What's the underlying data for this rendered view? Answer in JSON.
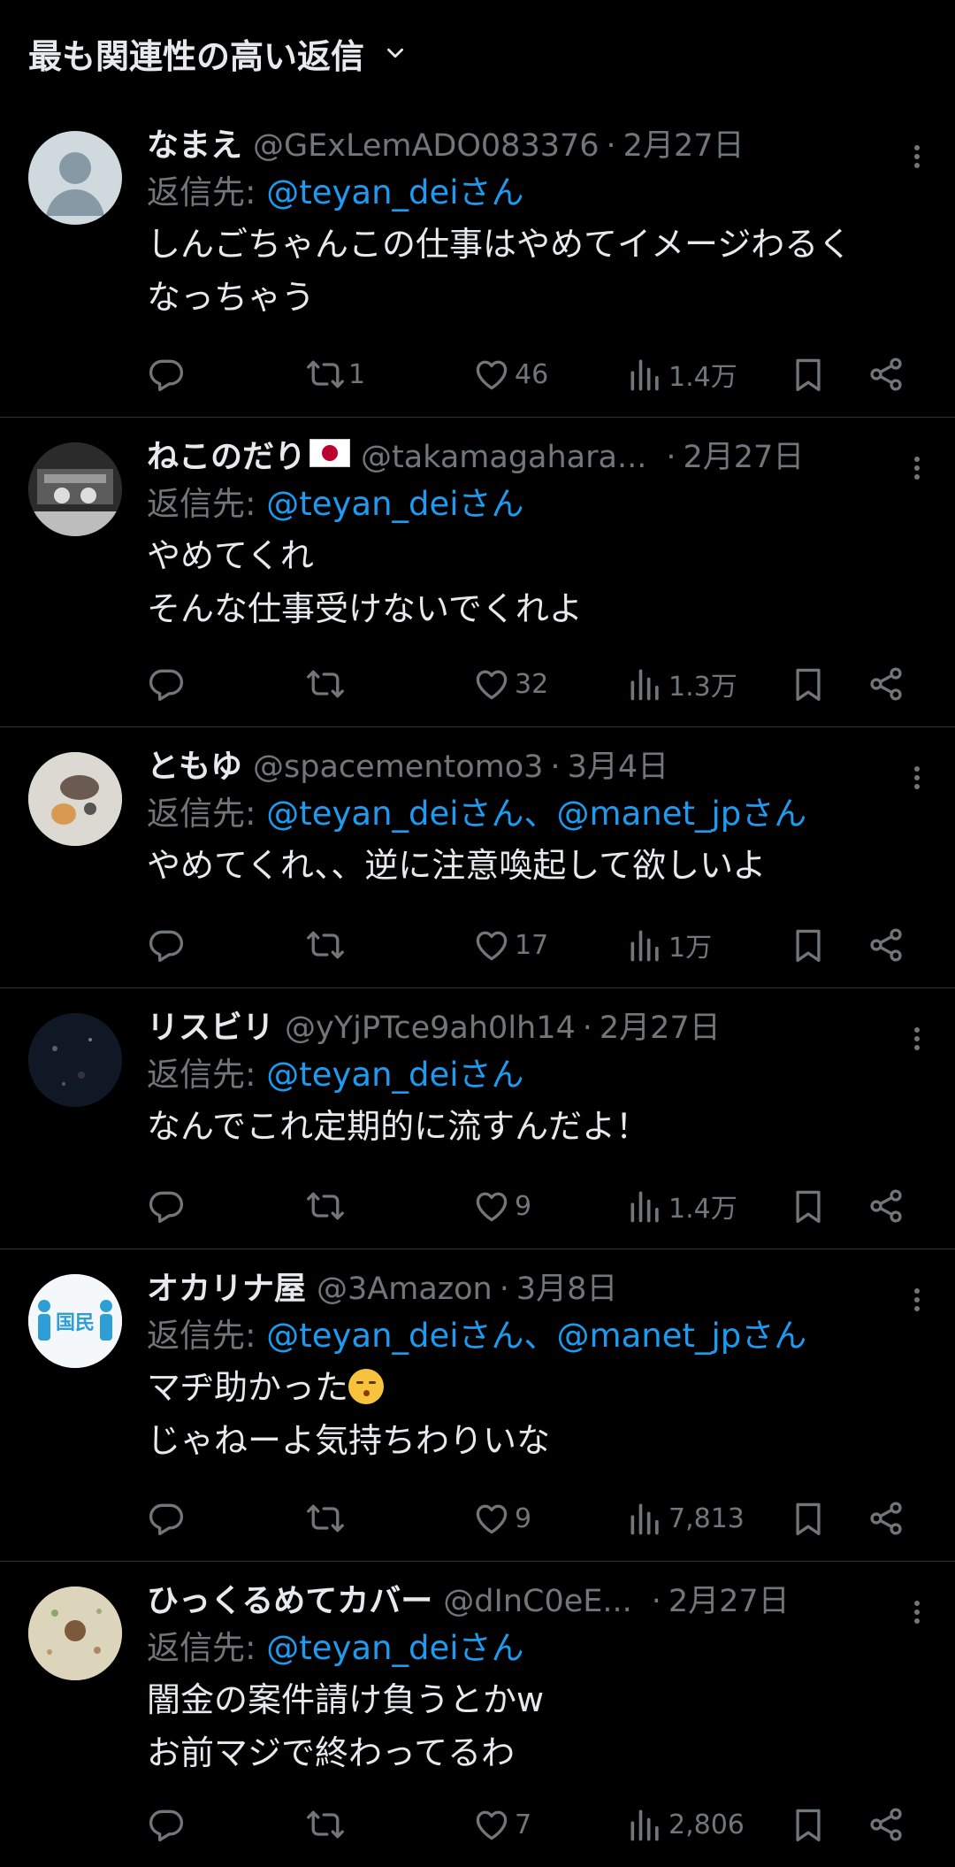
{
  "header": {
    "title": "最も関連性の高い返信"
  },
  "reply_prefix": "返信先:",
  "tweets": [
    {
      "name": "なまえ",
      "handle": "@GExLemADO083376",
      "date": "2月27日",
      "reply_to": "@teyan_deiさん",
      "text": "しんごちゃんこの仕事はやめてイメージわるく\nなっちゃう",
      "retweets": "1",
      "likes": "46",
      "views": "1.4万"
    },
    {
      "name": "ねこのだり",
      "handle": "@takamagahara...",
      "date": "2月27日",
      "reply_to": "@teyan_deiさん",
      "text": "やめてくれ\nそんな仕事受けないでくれよ",
      "retweets": "",
      "likes": "32",
      "views": "1.3万"
    },
    {
      "name": "ともゆ",
      "handle": "@spacementomo3",
      "date": "3月4日",
      "reply_to": "@teyan_deiさん、@manet_jpさん",
      "text": "やめてくれ、、逆に注意喚起して欲しいよ",
      "retweets": "",
      "likes": "17",
      "views": "1万"
    },
    {
      "name": "リスビリ",
      "handle": "@yYjPTce9ah0lh14",
      "date": "2月27日",
      "reply_to": "@teyan_deiさん",
      "text": "なんでこれ定期的に流すんだよ！",
      "retweets": "",
      "likes": "9",
      "views": "1.4万"
    },
    {
      "name": "オカリナ屋",
      "handle": "@3Amazon",
      "date": "3月8日",
      "reply_to": "@teyan_deiさん、@manet_jpさん",
      "text_line1": "マヂ助かった",
      "text_line2": "じゃねーよ気持ちわりいな",
      "avatar_text": "国民",
      "retweets": "",
      "likes": "9",
      "views": "7,813"
    },
    {
      "name": "ひっくるめてカバー",
      "handle": "@dInC0eE...",
      "date": "2月27日",
      "reply_to": "@teyan_deiさん",
      "text": "闇金の案件請け負うとかw\nお前マジで終わってるわ",
      "retweets": "",
      "likes": "7",
      "views": "2,806"
    }
  ],
  "colors": {
    "background": "#000000",
    "text": "#e7e9ea",
    "muted": "#71767b",
    "link": "#1d9bf0",
    "divider": "#2f3336"
  },
  "icons": [
    "chevron-down-icon",
    "more-icon",
    "reply-icon",
    "retweet-icon",
    "like-icon",
    "views-icon",
    "bookmark-icon",
    "share-icon",
    "japan-flag-icon",
    "kissing-face-emoji"
  ]
}
